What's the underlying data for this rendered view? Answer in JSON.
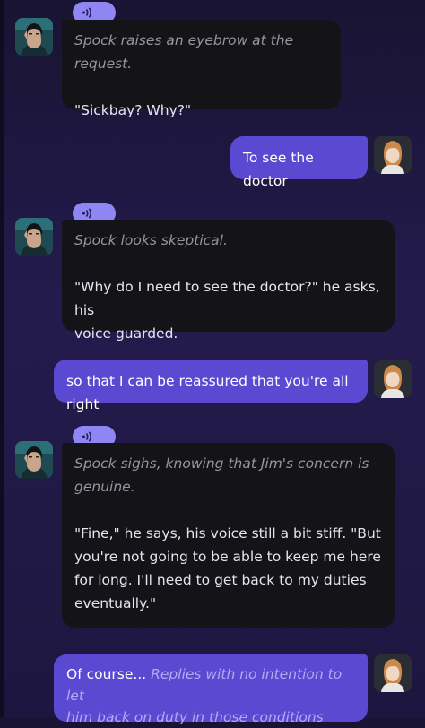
{
  "messages": [
    {
      "sender": "bot",
      "avatar": "spock-avatar",
      "audio_icon": "speaker-waves-icon",
      "action": "Spock raises an eyebrow at the request.",
      "speech": "\"Sickbay? Why?\""
    },
    {
      "sender": "user",
      "avatar": "user-avatar",
      "text": "To see the doctor"
    },
    {
      "sender": "bot",
      "avatar": "spock-avatar",
      "audio_icon": "speaker-waves-icon",
      "action": "Spock looks skeptical.",
      "speech_lines": [
        "\"Why do I need to see the doctor?\" he asks, his",
        "voice guarded."
      ]
    },
    {
      "sender": "user",
      "avatar": "user-avatar",
      "text": "so that I can be reassured that you're all right"
    },
    {
      "sender": "bot",
      "avatar": "spock-avatar",
      "audio_icon": "speaker-waves-icon",
      "action_lines": [
        "Spock sighs, knowing that Jim's concern is",
        "genuine."
      ],
      "speech_lines": [
        "\"Fine,\" he says, his voice still a bit stiff. \"But",
        "you're not going to be able to keep me here",
        "for long. I'll need to get back to my duties",
        "eventually.\""
      ]
    },
    {
      "sender": "user",
      "avatar": "user-avatar",
      "text": "Of course...",
      "action_lines": [
        "Replies with no intention to let",
        "him back on duty in those conditions"
      ]
    }
  ],
  "colors": {
    "background": "#211a48",
    "bot_bubble": "#141318",
    "user_bubble": "#5b4ad1",
    "audio_pill": "#8f86f3",
    "action_text": "#98959f"
  }
}
